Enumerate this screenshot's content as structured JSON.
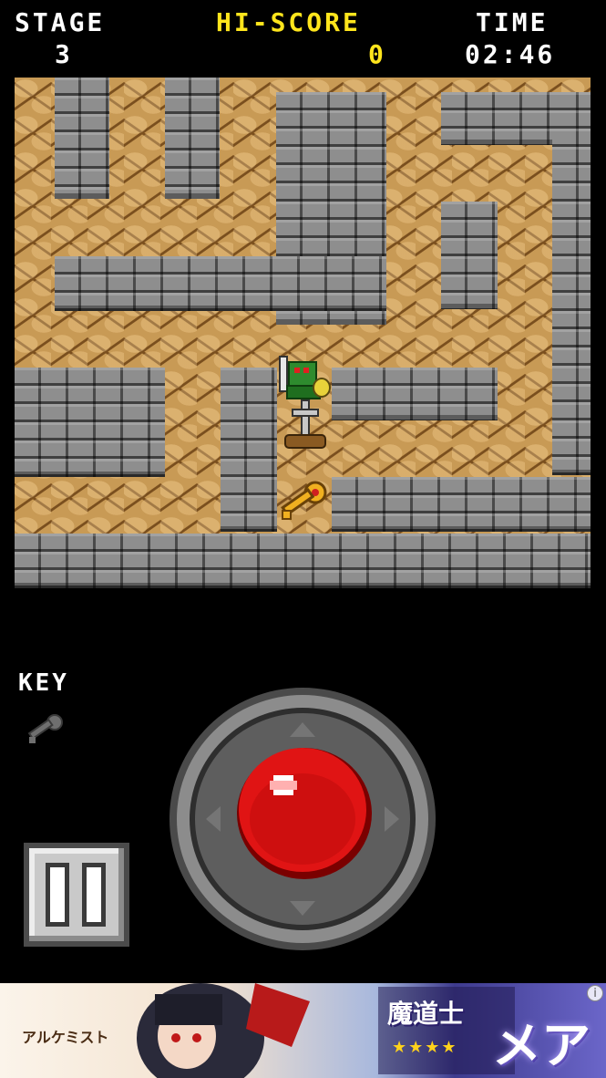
{
  "hud": {
    "stage_label": "STAGE",
    "stage_value": "3",
    "hiscore_label": "HI-SCORE",
    "hiscore_value": "0",
    "time_label": "TIME",
    "time_value": "02:46"
  },
  "inventory": {
    "key_label": "KEY",
    "key_collected": false
  },
  "controls": {
    "pause_icon": "pause-icon",
    "joystick_icon": "dpad-joystick-icon"
  },
  "ad": {
    "logo_text": "アルケミスト",
    "title": "魔道士",
    "stars": "★★★★",
    "name": "メア",
    "info_glyph": "i"
  },
  "colors": {
    "hud_white": "#ffffff",
    "hud_yellow": "#ffe51c",
    "floor": "#c89a55",
    "wall": "#8e8e8e",
    "joystick_ball": "#e01414"
  }
}
